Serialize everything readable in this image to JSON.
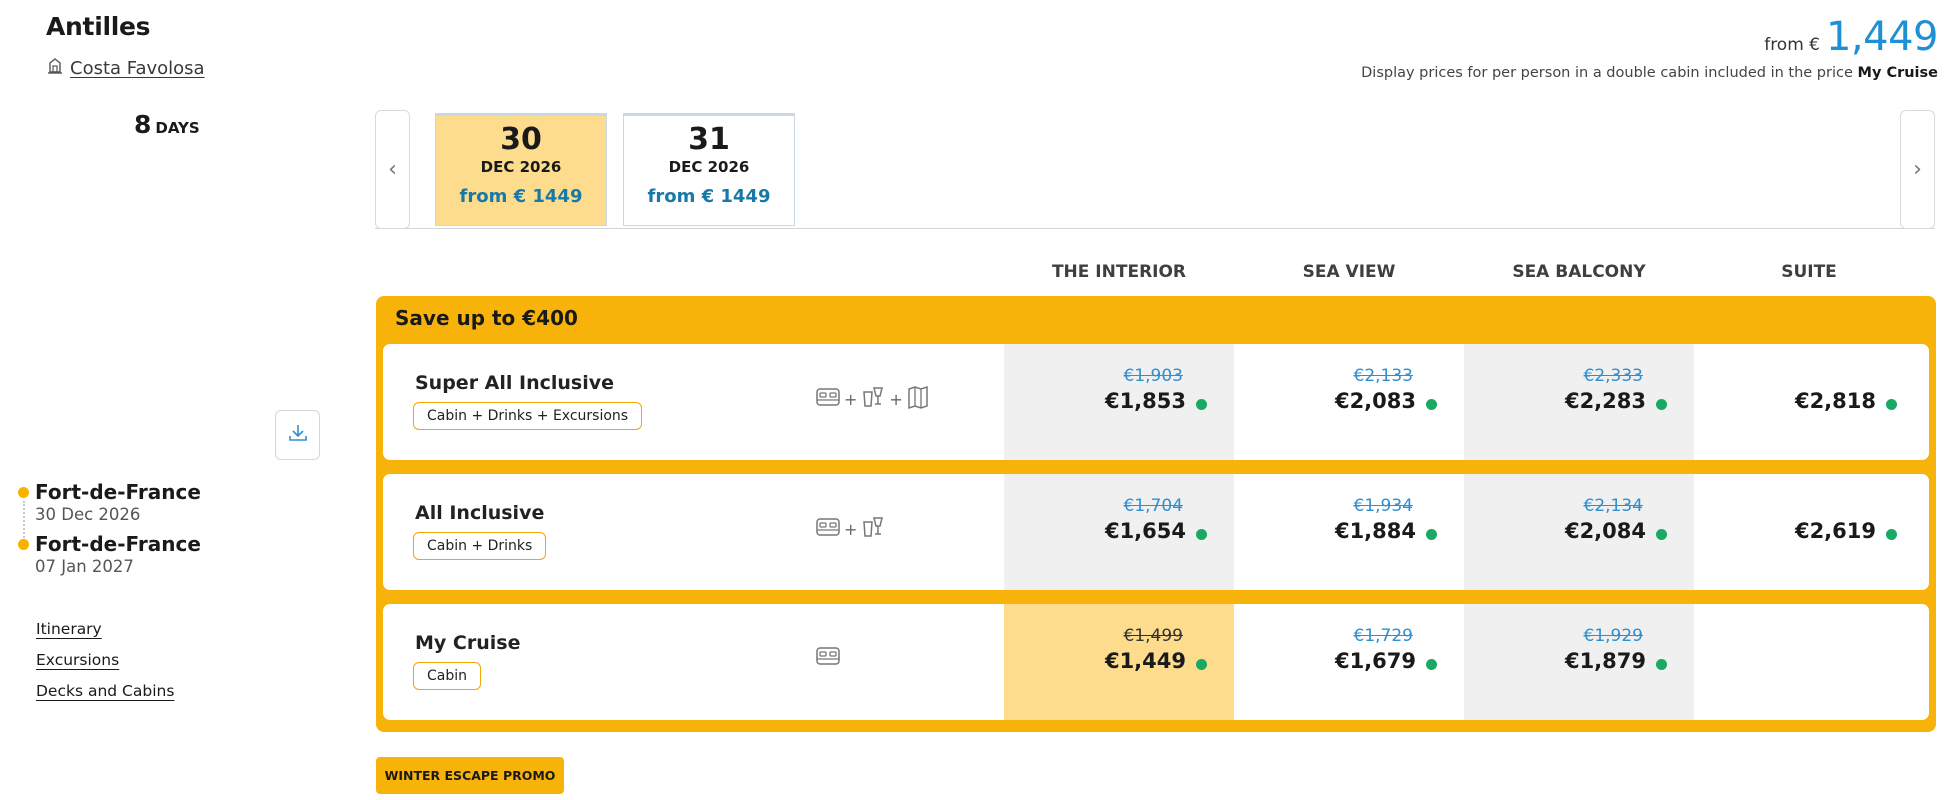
{
  "header": {
    "title": "Antilles",
    "ship": "Costa Favolosa",
    "days_value": "8",
    "days_unit": "DAYS"
  },
  "pricing": {
    "from_label": "from €",
    "from_value": "1,449",
    "note_prefix": "Display prices for per person in a double cabin included in the price",
    "note_bold": "My Cruise"
  },
  "route": {
    "departure": {
      "city": "Fort-de-France",
      "date": "30 Dec 2026"
    },
    "arrival": {
      "city": "Fort-de-France",
      "date": "07 Jan 2027"
    }
  },
  "side_links": [
    "Itinerary",
    "Excursions",
    "Decks and Cabins"
  ],
  "dates": [
    {
      "day": "30",
      "month": "DEC 2026",
      "price": "from € 1449",
      "active": true
    },
    {
      "day": "31",
      "month": "DEC 2026",
      "price": "from € 1449",
      "active": false
    }
  ],
  "columns": [
    "THE INTERIOR",
    "SEA VIEW",
    "SEA BALCONY",
    "SUITE"
  ],
  "promo": {
    "title": "Save up to €400",
    "tag": "WINTER ESCAPE PROMO"
  },
  "packages": [
    {
      "name": "Super All Inclusive",
      "badge": "Cabin + Drinks + Excursions",
      "icons": [
        "bed-icon",
        "drinks-icon",
        "map-icon"
      ],
      "prices": [
        {
          "old": "€1,903",
          "new": "€1,853"
        },
        {
          "old": "€2,133",
          "new": "€2,083"
        },
        {
          "old": "€2,333",
          "new": "€2,283"
        },
        {
          "old": "",
          "new": "€2,818"
        }
      ]
    },
    {
      "name": "All Inclusive",
      "badge": "Cabin + Drinks",
      "icons": [
        "bed-icon",
        "drinks-icon"
      ],
      "prices": [
        {
          "old": "€1,704",
          "new": "€1,654"
        },
        {
          "old": "€1,934",
          "new": "€1,884"
        },
        {
          "old": "€2,134",
          "new": "€2,084"
        },
        {
          "old": "",
          "new": "€2,619"
        }
      ]
    },
    {
      "name": "My Cruise",
      "badge": "Cabin",
      "icons": [
        "bed-icon"
      ],
      "prices": [
        {
          "old": "€1,499",
          "new": "€1,449"
        },
        {
          "old": "€1,729",
          "new": "€1,679"
        },
        {
          "old": "€1,929",
          "new": "€1,879"
        }
      ]
    }
  ],
  "colors": {
    "accent": "#f7b30a",
    "selected": "#fddc8d",
    "link_blue": "#1e90d6",
    "available": "#1aa864"
  }
}
